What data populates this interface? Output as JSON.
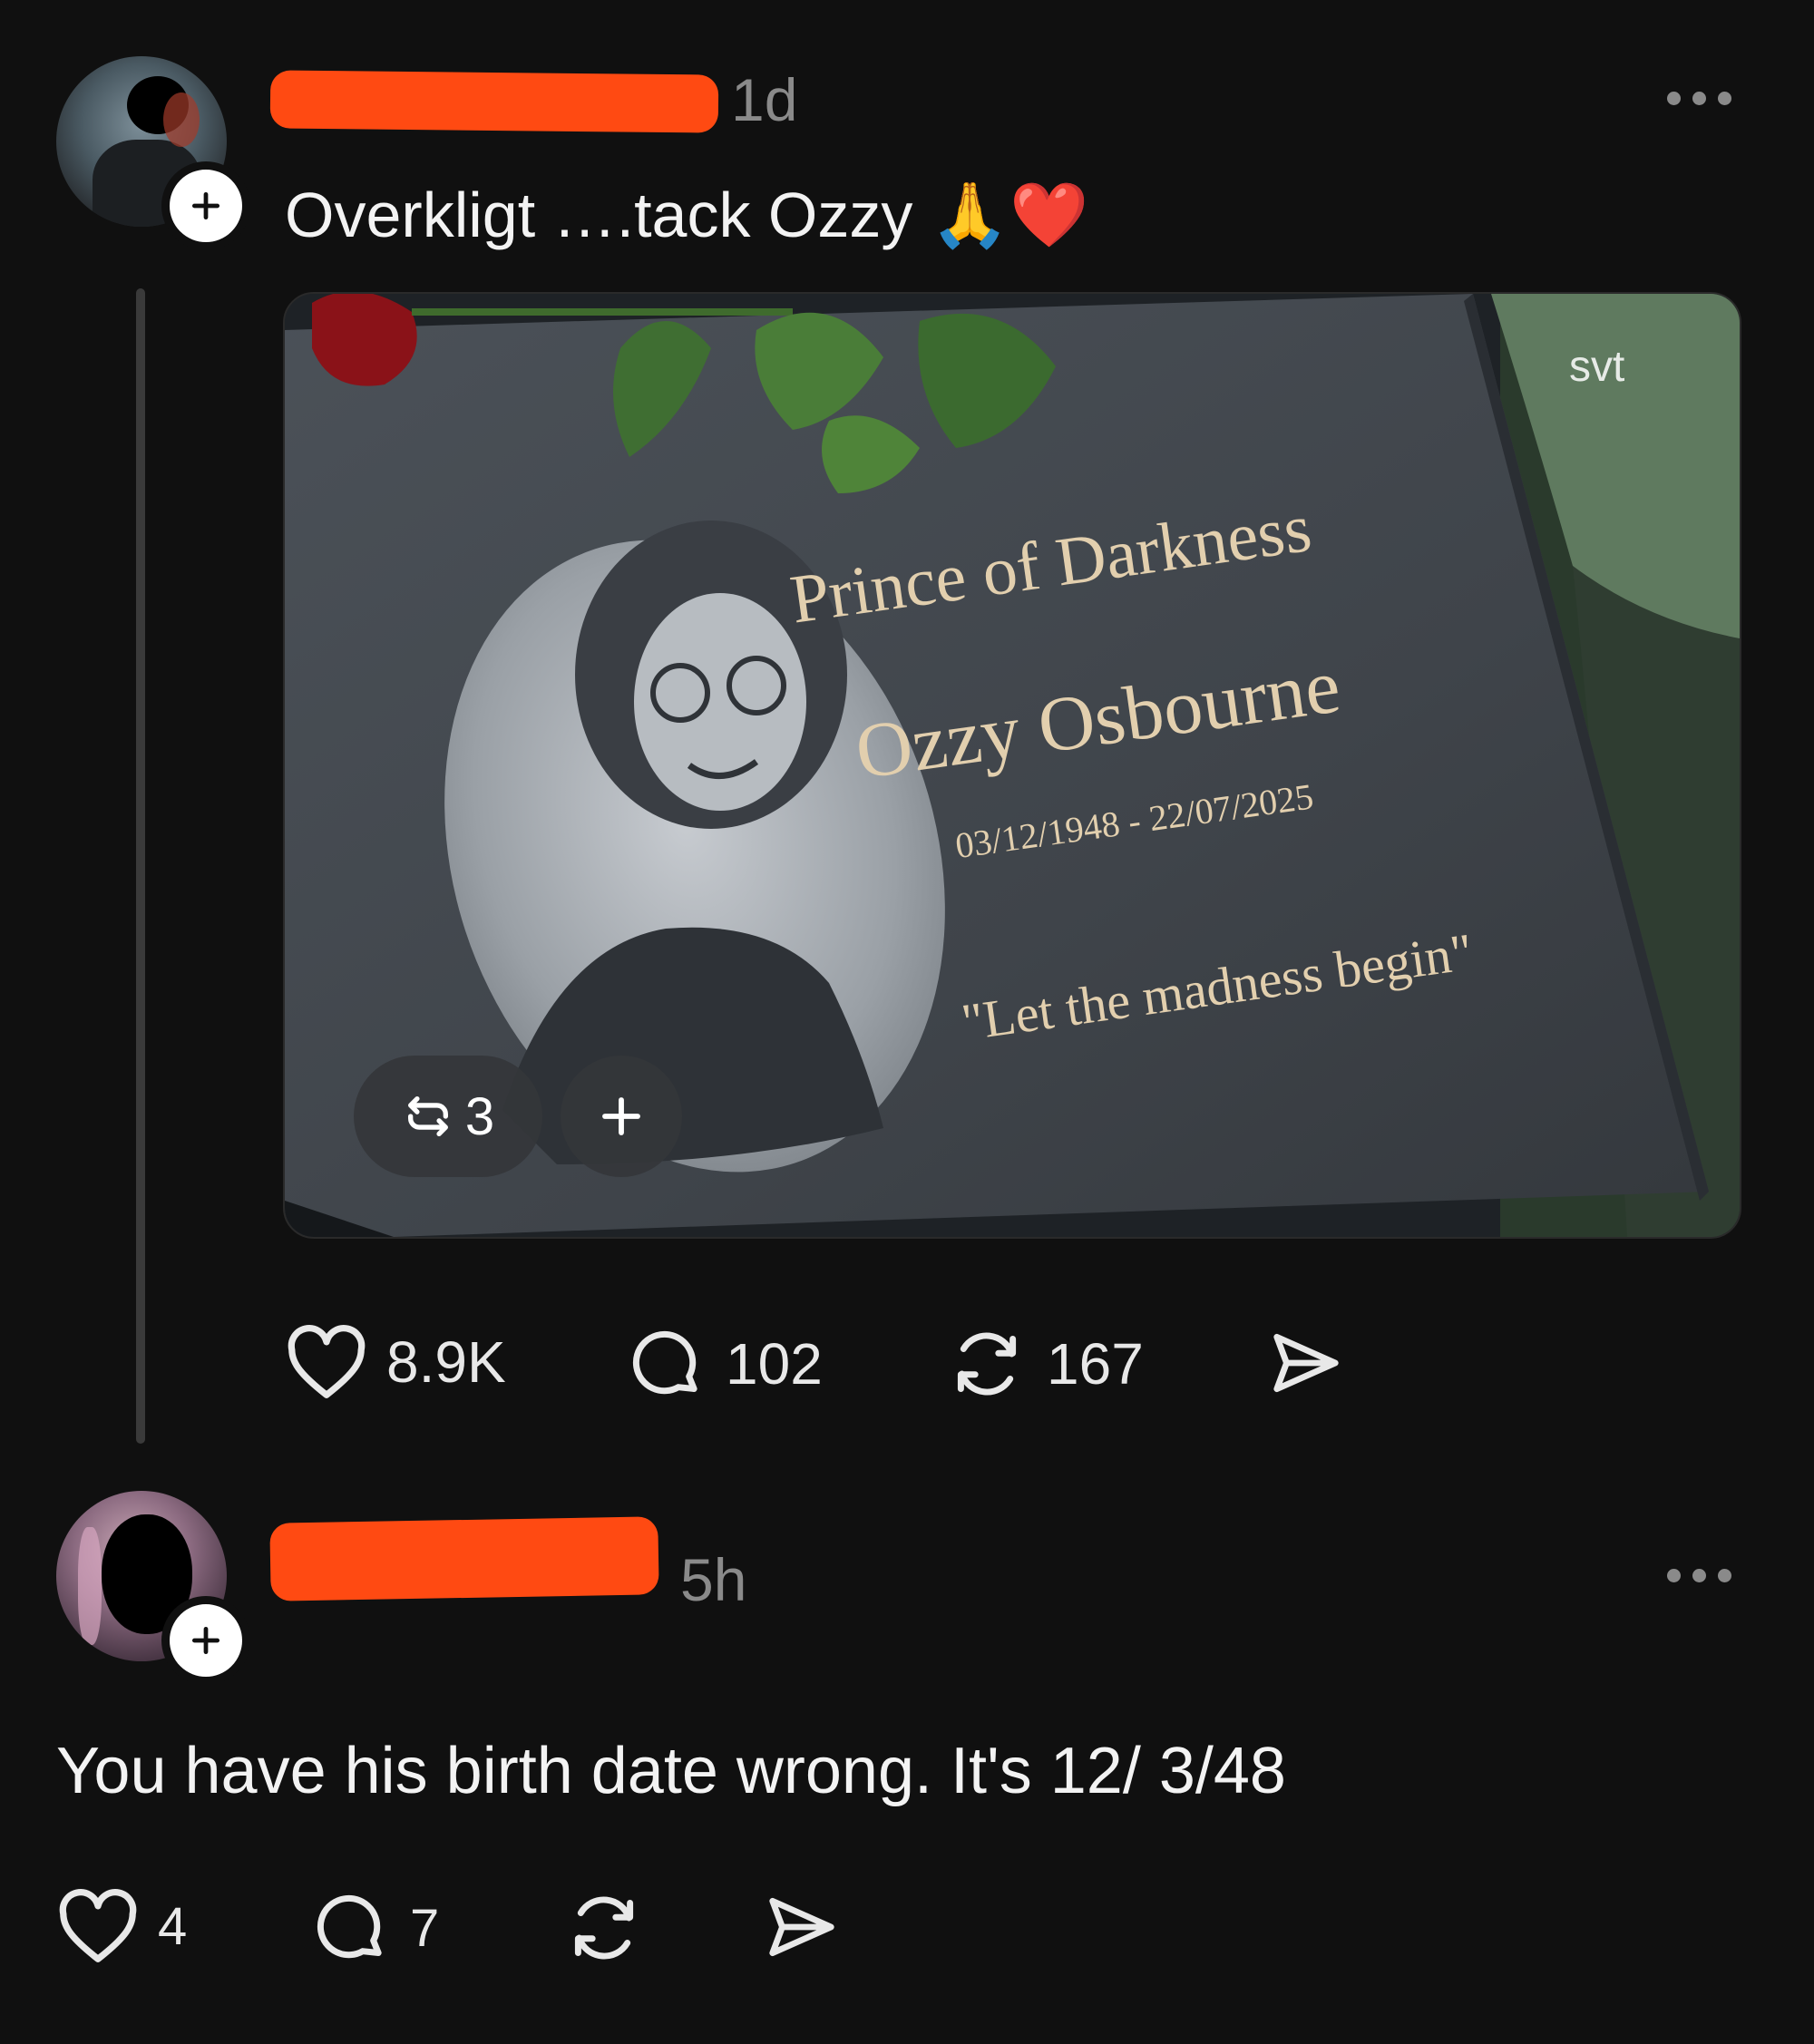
{
  "post": {
    "time": "1d",
    "text": "Overkligt ….tack Ozzy",
    "emoji": "🙏❤️",
    "image": {
      "watermark": "svt",
      "title": "Prince of Darkness",
      "name": "Ozzy Osbourne",
      "dates": "03/12/1948 - 22/07/2025",
      "quote": "\"Let the madness begin\""
    },
    "repost_badge_count": "3",
    "stats": {
      "likes": "8.9K",
      "comments": "102",
      "reposts": "167"
    }
  },
  "reply": {
    "time": "5h",
    "text": "You have his birth date wrong. It's 12/ 3/48",
    "stats": {
      "likes": "4",
      "comments": "7"
    }
  },
  "icons": {
    "more": "more-dots-icon",
    "follow": "plus-icon",
    "like": "heart-icon",
    "comment": "comment-bubble-icon",
    "repost": "repost-icon",
    "share": "send-icon"
  },
  "colors": {
    "background": "#101010",
    "redaction": "#ff4a12",
    "muted_text": "#8a8a8a",
    "engraving": "#e2cfae"
  }
}
